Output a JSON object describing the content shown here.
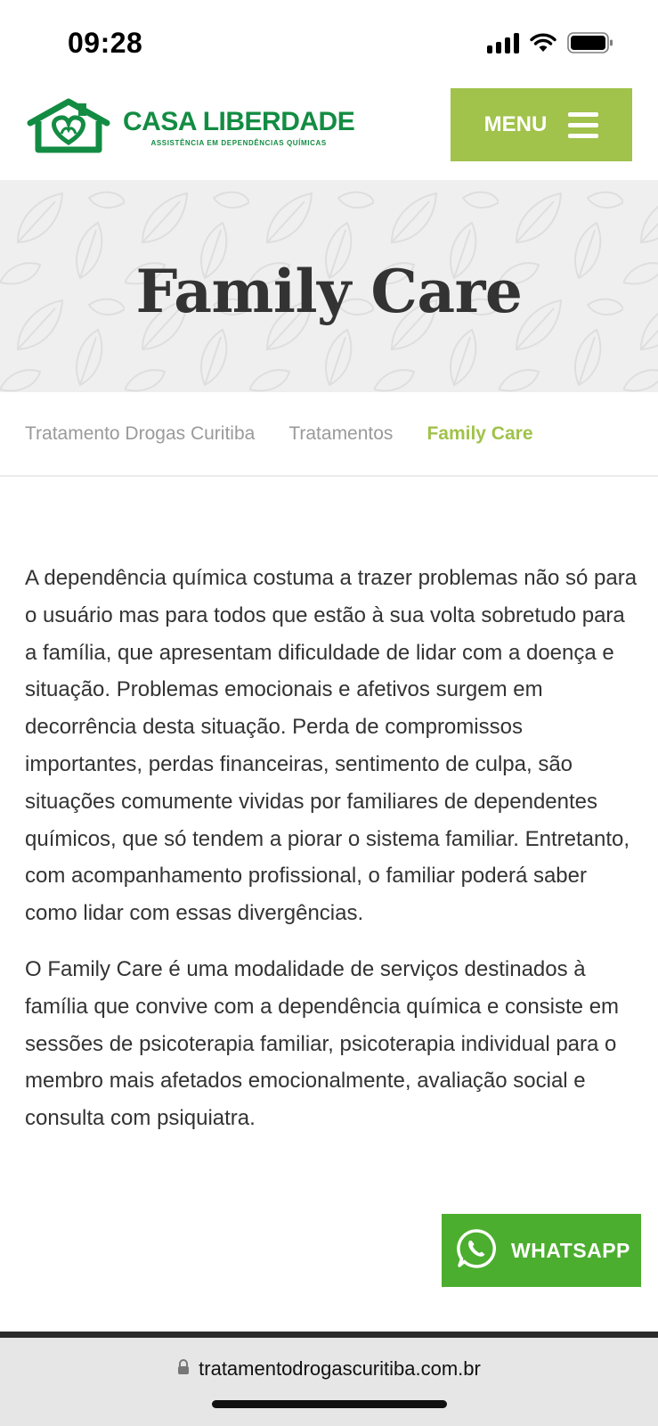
{
  "status_bar": {
    "time": "09:28",
    "icons": [
      "signal-icon",
      "wifi-icon",
      "battery-icon"
    ]
  },
  "header": {
    "logo": {
      "name": "CASA LIBERDADE",
      "tagline": "ASSISTÊNCIA EM DEPENDÊNCIAS QUÍMICAS",
      "icon": "house-heart-icon"
    },
    "menu": {
      "label": "MENU",
      "icon": "hamburger-icon"
    }
  },
  "hero": {
    "title": "Family Care"
  },
  "breadcrumb": [
    {
      "label": "Tratamento Drogas Curitiba"
    },
    {
      "label": "Tratamentos"
    },
    {
      "label": "Family Care"
    }
  ],
  "content": {
    "paragraphs": [
      "A dependência química costuma a trazer problemas não só para o usuário mas para todos que estão à sua volta sobretudo para a família, que apresentam dificuldade de lidar com a doença e situação. Problemas emocionais e afetivos surgem em decorrência desta situação. Perda de compromissos importantes, perdas financeiras, sentimento de culpa, são situações comumente vividas por familiares de dependentes químicos, que só tendem a piorar o sistema familiar. Entretanto, com acompanhamento profissional, o familiar poderá saber como lidar com essas divergências.",
      "O Family Care é uma modalidade de serviços destinados à família que convive com a dependência química e consiste em sessões de psicoterapia familiar, psicoterapia individual para o membro mais afetados emocionalmente, avaliação social e consulta com psiquiatra."
    ]
  },
  "whatsapp": {
    "label": "WHATSAPP",
    "icon": "whatsapp-icon"
  },
  "browser": {
    "url": "tratamentodrogascuritiba.com.br",
    "icon": "lock-icon"
  },
  "colors": {
    "brand_green": "#138c43",
    "accent_olive": "#a1c24b",
    "whatsapp_green": "#4cae2f",
    "hero_bg": "#efefef",
    "text": "#333333",
    "breadcrumb_inactive": "#9a9a9a"
  }
}
